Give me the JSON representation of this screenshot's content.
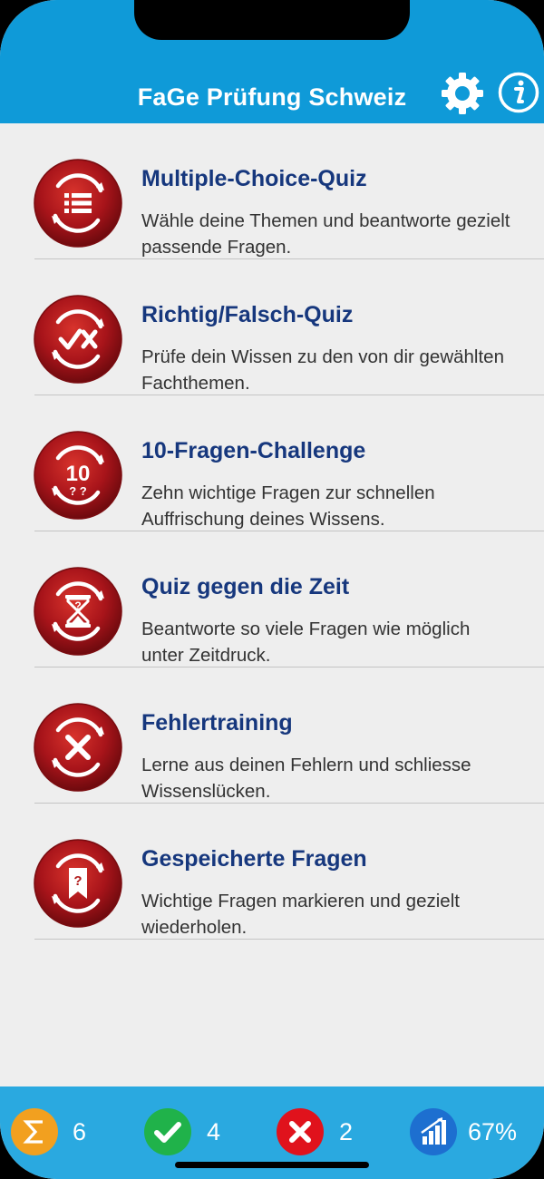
{
  "header": {
    "title": "FaGe Prüfung Schweiz",
    "settings_icon": "gear-icon",
    "info_icon": "info-icon"
  },
  "colors": {
    "header_bg": "#0f9ad8",
    "footer_bg": "#2aa9e0",
    "title_text": "#16377d",
    "icon_red": "#b01a1a",
    "sum_badge": "#f2a01f",
    "correct_badge": "#20b24a",
    "wrong_badge": "#e0121c",
    "rate_badge": "#1d6fd0"
  },
  "menu": {
    "items": [
      {
        "title": "Multiple-Choice-Quiz",
        "desc_line1": "Wähle deine Themen und beantworte gezielt",
        "desc_line2": "passende Fragen.",
        "icon": "multiple-choice-icon"
      },
      {
        "title": "Richtig/Falsch-Quiz",
        "desc_line1": "Prüfe dein Wissen zu den von dir gewählten",
        "desc_line2": "Fachthemen.",
        "icon": "true-false-icon"
      },
      {
        "title": "10-Fragen-Challenge",
        "desc_line1": "Zehn wichtige Fragen zur schnellen",
        "desc_line2": "Auffrischung deines Wissens.",
        "icon": "ten-questions-icon",
        "icon_text": "10",
        "icon_subtext": "? ?"
      },
      {
        "title": "Quiz gegen die Zeit",
        "desc_line1": "Beantworte so viele Fragen wie möglich",
        "desc_line2": "unter Zeitdruck.",
        "icon": "hourglass-icon"
      },
      {
        "title": "Fehlertraining",
        "desc_line1": "Lerne aus deinen Fehlern und schliesse",
        "desc_line2": "Wissenslücken.",
        "icon": "error-training-icon"
      },
      {
        "title": "Gespeicherte Fragen",
        "desc_line1": "Wichtige Fragen markieren und gezielt",
        "desc_line2": "wiederholen.",
        "icon": "bookmark-icon",
        "icon_text": "?"
      }
    ]
  },
  "stats": {
    "total": {
      "icon": "sigma-icon",
      "value": "6"
    },
    "correct": {
      "icon": "checkmark-icon",
      "value": "4"
    },
    "wrong": {
      "icon": "cross-icon",
      "value": "2"
    },
    "rate": {
      "icon": "bar-chart-icon",
      "value": "67%"
    }
  }
}
